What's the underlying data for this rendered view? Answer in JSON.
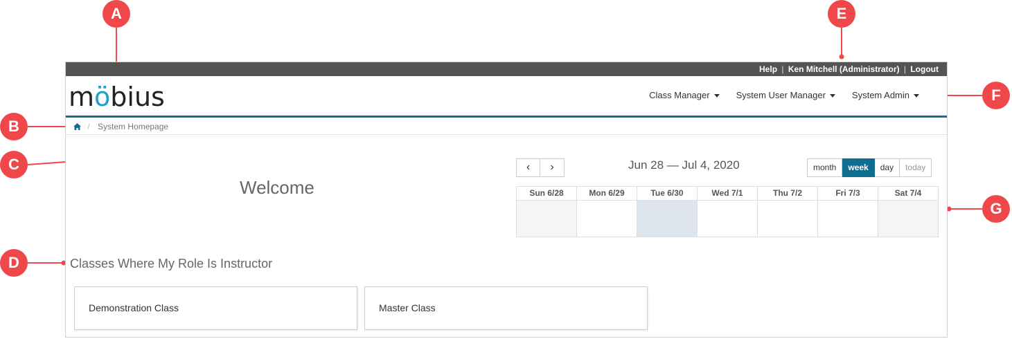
{
  "topbar": {
    "help": "Help",
    "user": "Ken Mitchell (Administrator)",
    "logout": "Logout",
    "separator": "|"
  },
  "brand": {
    "logo_text": "mobius",
    "logo_prefix": "m",
    "logo_o": "ö",
    "logo_suffix": "bius",
    "accent_color": "#1da0c9"
  },
  "nav": {
    "items": [
      {
        "label": "Class Manager"
      },
      {
        "label": "System User Manager"
      },
      {
        "label": "System Admin"
      }
    ]
  },
  "breadcrumb": {
    "home_icon": "home-icon",
    "separator": "/",
    "current": "System Homepage"
  },
  "main": {
    "welcome": "Welcome",
    "section_title": "Classes Where My Role Is Instructor",
    "classes": [
      {
        "name": "Demonstration Class"
      },
      {
        "name": "Master Class"
      }
    ]
  },
  "calendar": {
    "prev": "‹",
    "next": "›",
    "title": "Jun 28 — Jul 4, 2020",
    "views": [
      "month",
      "week",
      "day",
      "today"
    ],
    "active_view": "week",
    "days": [
      "Sun 6/28",
      "Mon 6/29",
      "Tue 6/30",
      "Wed 7/1",
      "Thu 7/2",
      "Fri 7/3",
      "Sat 7/4"
    ],
    "highlighted_day": "Tue 6/30"
  },
  "callouts": [
    "A",
    "B",
    "C",
    "D",
    "E",
    "F",
    "G"
  ],
  "colors": {
    "topbar_bg": "#545454",
    "nav_accent": "#0f6e8f",
    "callout": "#f0474a"
  }
}
